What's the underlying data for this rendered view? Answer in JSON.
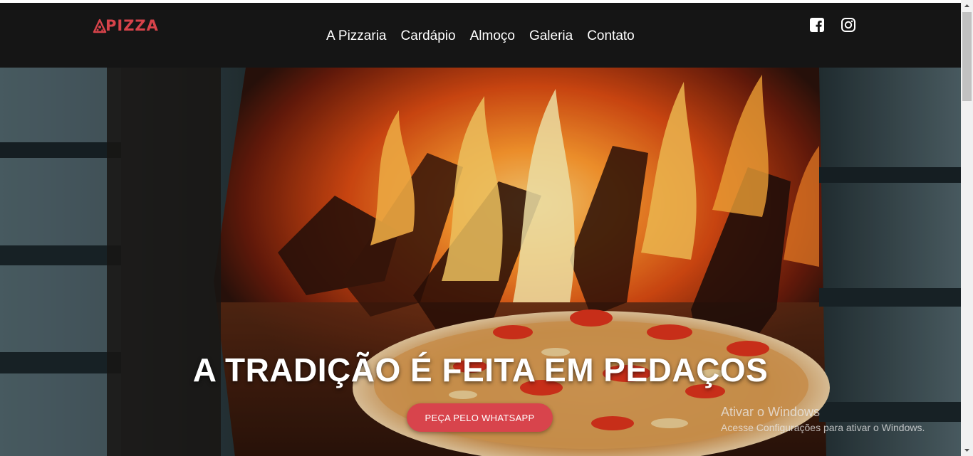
{
  "brand": {
    "name": "PIZZA",
    "color": "#d7434a"
  },
  "nav": {
    "items": [
      {
        "label": "A Pizzaria"
      },
      {
        "label": "Cardápio"
      },
      {
        "label": "Almoço"
      },
      {
        "label": "Galeria"
      },
      {
        "label": "Contato"
      }
    ]
  },
  "social": {
    "icons": [
      "facebook-icon",
      "instagram-icon"
    ]
  },
  "hero": {
    "title": "A TRADIÇÃO É FEITA EM PEDAÇOS",
    "cta_label": "PEÇA PELO WHATSAPP",
    "cta_color": "#d8444c"
  },
  "watermark": {
    "title": "Ativar o Windows",
    "subtitle": "Acesse Configurações para ativar o Windows."
  },
  "colors": {
    "navbar_bg": "#151515",
    "accent": "#d7434a"
  }
}
